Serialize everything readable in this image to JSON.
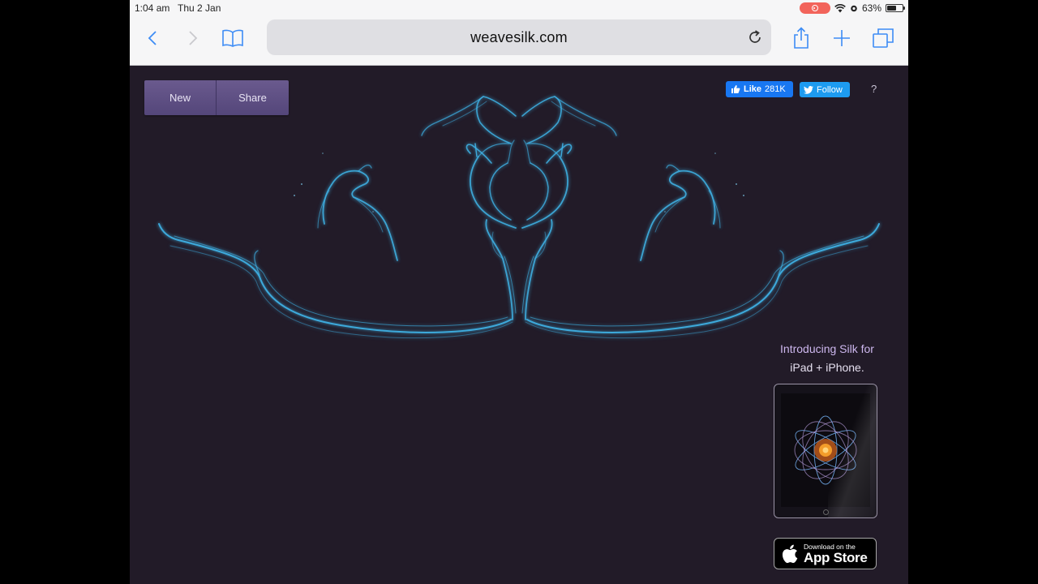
{
  "status_bar": {
    "time": "1:04 am",
    "date": "Thu 2 Jan",
    "battery": "63%",
    "battery_level": 0.63
  },
  "browser": {
    "url": "weavesilk.com",
    "icons": [
      "back-icon",
      "forward-icon",
      "bookmarks-icon",
      "reload-icon",
      "share-icon",
      "new-tab-icon",
      "tabs-icon"
    ]
  },
  "page": {
    "new_label": "New",
    "share_label": "Share",
    "fb_like_label": "Like",
    "fb_like_count": "281K",
    "twitter_follow_label": "Follow",
    "help_label": "?",
    "promo_line1": "Introducing Silk for",
    "promo_line2": "iPad + iPhone.",
    "appstore_small": "Download on the",
    "appstore_big": "App Store"
  },
  "colors": {
    "canvas_bg": "#221b28",
    "silk_stroke": "#3fb4e8",
    "button_purple": "#5e4f84",
    "promo_text": "#cdb7ee"
  }
}
